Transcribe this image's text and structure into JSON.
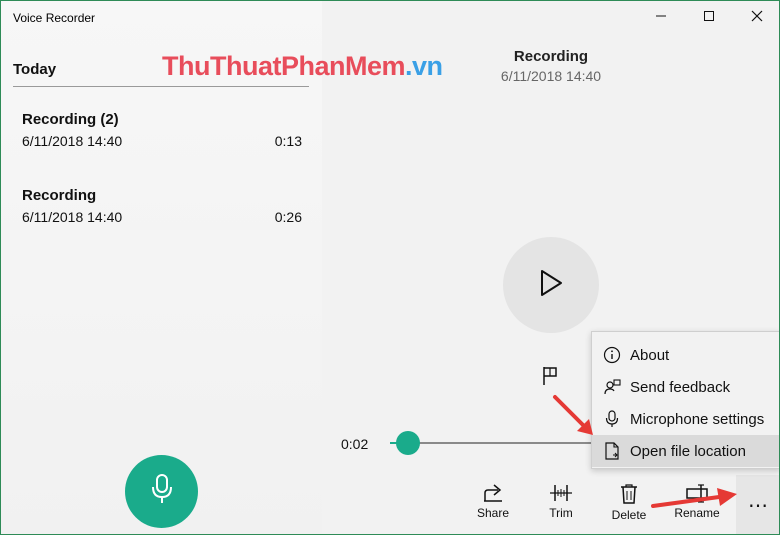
{
  "app": {
    "title": "Voice Recorder"
  },
  "watermark": {
    "part1": "ThuThuat",
    "part2": "PhanMem",
    "part3": ".vn"
  },
  "list": {
    "section": "Today",
    "items": [
      {
        "name": "Recording (2)",
        "date": "6/11/2018 14:40",
        "duration": "0:13"
      },
      {
        "name": "Recording",
        "date": "6/11/2018 14:40",
        "duration": "0:26"
      }
    ]
  },
  "player": {
    "title": "Recording",
    "date": "6/11/2018 14:40",
    "current_time": "0:02",
    "progress_fraction": 0.08
  },
  "toolbar": {
    "share": "Share",
    "trim": "Trim",
    "delete": "Delete",
    "rename": "Rename",
    "more": "⋯"
  },
  "menu": {
    "items": [
      {
        "label": "About",
        "icon": "info-icon"
      },
      {
        "label": "Send feedback",
        "icon": "feedback-icon"
      },
      {
        "label": "Microphone settings",
        "icon": "microphone-icon"
      },
      {
        "label": "Open file location",
        "icon": "file-icon"
      }
    ],
    "highlighted_index": 3
  },
  "colors": {
    "accent": "#1aab8b",
    "annotation_arrow": "#e53935",
    "watermark_red": "#e84d5b",
    "watermark_blue": "#3aa0e6"
  }
}
